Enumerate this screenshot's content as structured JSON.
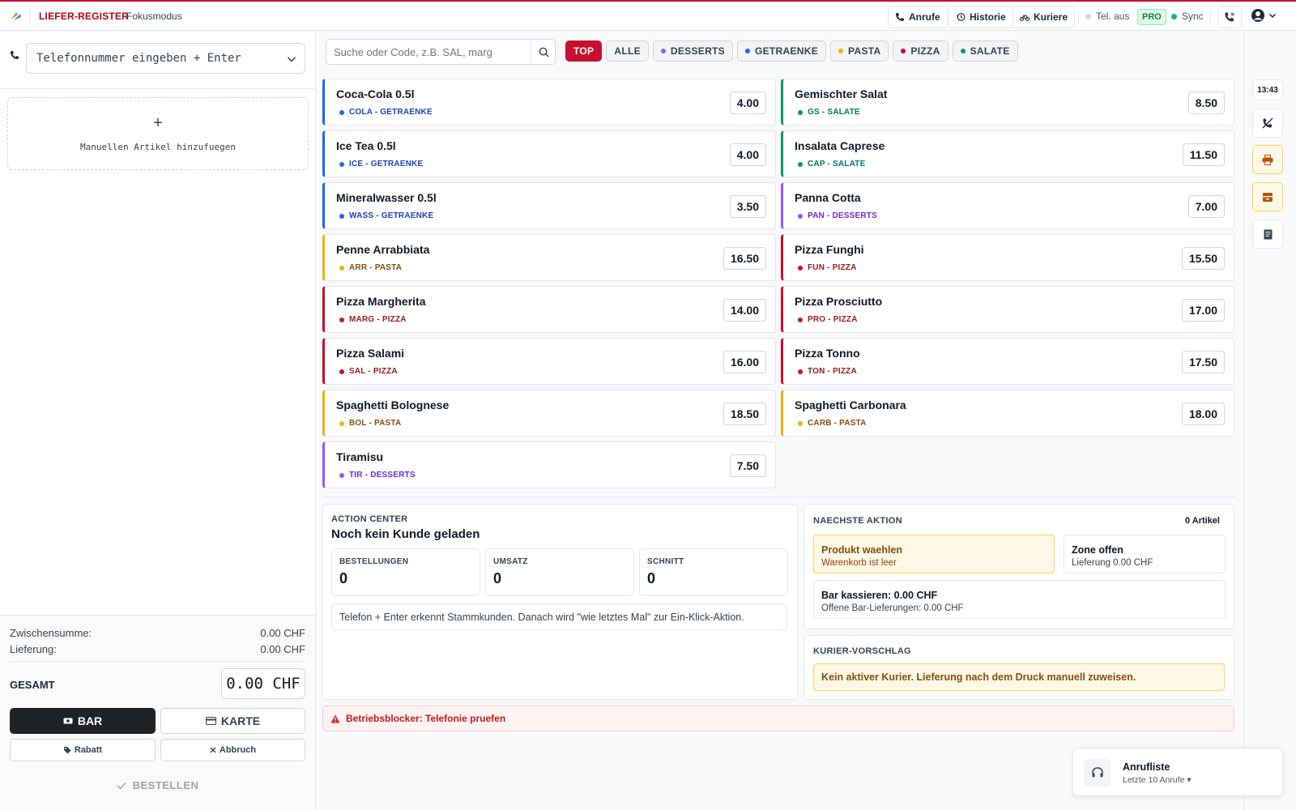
{
  "header": {
    "brand": "LIEFER-REGISTER",
    "mode": "Fokusmodus",
    "buttons": {
      "calls": "Anrufe",
      "history": "Historie",
      "couriers": "Kuriere"
    },
    "tel_status": "Tel. aus",
    "plan": "PRO",
    "sync": "Sync",
    "status_colors": {
      "tel": "#d1d5db",
      "sync": "#10b981"
    }
  },
  "left": {
    "phone_placeholder": "Telefonnummer eingeben + Enter",
    "manual_plus": "+",
    "manual_label": "Manuellen Artikel hinzufuegen",
    "subtotal_label": "Zwischensumme:",
    "subtotal_value": "0.00 CHF",
    "delivery_label": "Lieferung:",
    "delivery_value": "0.00 CHF",
    "total_label": "GESAMT",
    "total_value": "0.00 CHF",
    "cash_label": "BAR",
    "card_label": "KARTE",
    "discount_label": "Rabatt",
    "cancel_label": "Abbruch",
    "order_label": "BESTELLEN"
  },
  "search": {
    "placeholder": "Suche oder Code, z.B. SAL, marg"
  },
  "filters": [
    {
      "label": "TOP",
      "active": true,
      "dot": ""
    },
    {
      "label": "ALLE",
      "active": false,
      "dot": ""
    },
    {
      "label": "DESSERTS",
      "active": false,
      "dot": "#8b5cf6"
    },
    {
      "label": "GETRAENKE",
      "active": false,
      "dot": "#2563eb"
    },
    {
      "label": "PASTA",
      "active": false,
      "dot": "#eab308"
    },
    {
      "label": "PIZZA",
      "active": false,
      "dot": "#c8102e"
    },
    {
      "label": "SALATE",
      "active": false,
      "dot": "#059669"
    }
  ],
  "products": [
    {
      "name": "Coca-Cola 0.5l",
      "code": "COLA - GETRAENKE",
      "price": "4.00",
      "cat": "getraenke"
    },
    {
      "name": "Gemischter Salat",
      "code": "GS - SALATE",
      "price": "8.50",
      "cat": "salate"
    },
    {
      "name": "Ice Tea 0.5l",
      "code": "ICE - GETRAENKE",
      "price": "4.00",
      "cat": "getraenke"
    },
    {
      "name": "Insalata Caprese",
      "code": "CAP - SALATE",
      "price": "11.50",
      "cat": "salate"
    },
    {
      "name": "Mineralwasser 0.5l",
      "code": "WASS - GETRAENKE",
      "price": "3.50",
      "cat": "getraenke"
    },
    {
      "name": "Panna Cotta",
      "code": "PAN - DESSERTS",
      "price": "7.00",
      "cat": "desserts"
    },
    {
      "name": "Penne Arrabbiata",
      "code": "ARR - PASTA",
      "price": "16.50",
      "cat": "pasta"
    },
    {
      "name": "Pizza Funghi",
      "code": "FUN - PIZZA",
      "price": "15.50",
      "cat": "pizza"
    },
    {
      "name": "Pizza Margherita",
      "code": "MARG - PIZZA",
      "price": "14.00",
      "cat": "pizza"
    },
    {
      "name": "Pizza Prosciutto",
      "code": "PRO - PIZZA",
      "price": "17.00",
      "cat": "pizza"
    },
    {
      "name": "Pizza Salami",
      "code": "SAL - PIZZA",
      "price": "16.00",
      "cat": "pizza"
    },
    {
      "name": "Pizza Tonno",
      "code": "TON - PIZZA",
      "price": "17.50",
      "cat": "pizza"
    },
    {
      "name": "Spaghetti Bolognese",
      "code": "BOL - PASTA",
      "price": "18.50",
      "cat": "pasta"
    },
    {
      "name": "Spaghetti Carbonara",
      "code": "CARB - PASTA",
      "price": "18.00",
      "cat": "pasta"
    },
    {
      "name": "Tiramisu",
      "code": "TIR - DESSERTS",
      "price": "7.50",
      "cat": "desserts"
    }
  ],
  "action_center": {
    "eyebrow": "ACTION CENTER",
    "title": "Noch kein Kunde geladen",
    "stats": [
      {
        "label": "BESTELLUNGEN",
        "value": "0"
      },
      {
        "label": "UMSATZ",
        "value": "0"
      },
      {
        "label": "SCHNITT",
        "value": "0"
      }
    ],
    "hint": "Telefon + Enter erkennt Stammkunden. Danach wird \"wie letztes Mal\" zur Ein-Klick-Aktion."
  },
  "next_action": {
    "eyebrow": "NAECHSTE AKTION",
    "count": "0 Artikel",
    "product_title": "Produkt waehlen",
    "product_sub": "Warenkorb ist leer",
    "zone_title": "Zone offen",
    "zone_sub": "Lieferung 0.00 CHF",
    "cash_title": "Bar kassieren: 0.00 CHF",
    "cash_sub": "Offene Bar-Lieferungen: 0.00 CHF"
  },
  "courier": {
    "eyebrow": "KURIER-VORSCHLAG",
    "message": "Kein aktiver Kurier. Lieferung nach dem Druck manuell zuweisen."
  },
  "blocker": "Betriebsblocker: Telefonie pruefen",
  "rail": {
    "clock": "13:43"
  },
  "calls_widget": {
    "title": "Anrufliste",
    "subtitle": "Letzte 10 Anrufe ▾"
  }
}
